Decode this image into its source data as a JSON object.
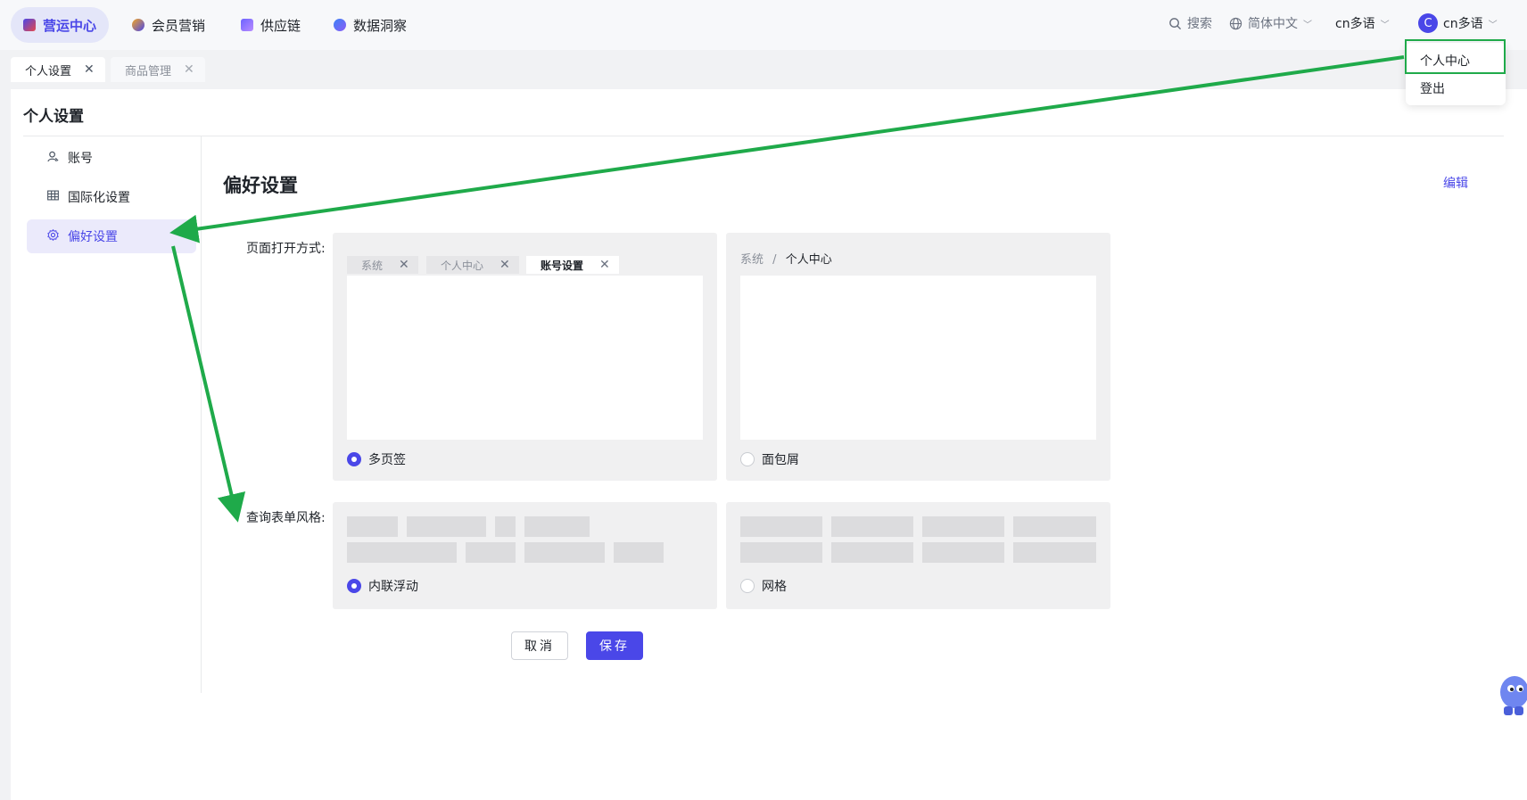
{
  "top_nav": {
    "tabs": [
      {
        "label": "营运中心",
        "icon": "ops-center-icon",
        "color": "#4a47e8"
      },
      {
        "label": "会员营销",
        "icon": "member-marketing-icon",
        "color": "#f5a623"
      },
      {
        "label": "供应链",
        "icon": "supply-chain-icon",
        "color": "#6c63ff"
      },
      {
        "label": "数据洞察",
        "icon": "data-insight-icon",
        "color": "#3b82f6"
      }
    ],
    "search_label": "搜索",
    "language_label": "简体中文",
    "locale_label": "cn多语",
    "user_initial": "C",
    "user_name": "cn多语"
  },
  "user_menu": {
    "items": [
      "个人中心",
      "登出"
    ]
  },
  "page_tabs": [
    {
      "label": "个人设置",
      "active": true
    },
    {
      "label": "商品管理",
      "active": false
    }
  ],
  "page": {
    "title": "个人设置",
    "menu": [
      {
        "label": "账号",
        "icon": "user-icon"
      },
      {
        "label": "国际化设置",
        "icon": "table-icon"
      },
      {
        "label": "偏好设置",
        "icon": "gear-icon"
      }
    ],
    "section_title": "偏好设置",
    "edit_label": "编辑",
    "open_mode": {
      "label": "页面打开方式:",
      "tab_preview": [
        "系统",
        "个人中心",
        "账号设置"
      ],
      "breadcrumb_root": "系统",
      "breadcrumb_sep": "/",
      "breadcrumb_leaf": "个人中心",
      "options": [
        {
          "label": "多页签",
          "checked": true
        },
        {
          "label": "面包屑",
          "checked": false
        }
      ]
    },
    "form_style": {
      "label": "查询表单风格:",
      "options": [
        {
          "label": "内联浮动",
          "checked": true
        },
        {
          "label": "网格",
          "checked": false
        }
      ]
    },
    "cancel_label": "取消",
    "save_label": "保存"
  },
  "colors": {
    "accent": "#4a47e8",
    "annotation_green": "#1faa4a"
  }
}
